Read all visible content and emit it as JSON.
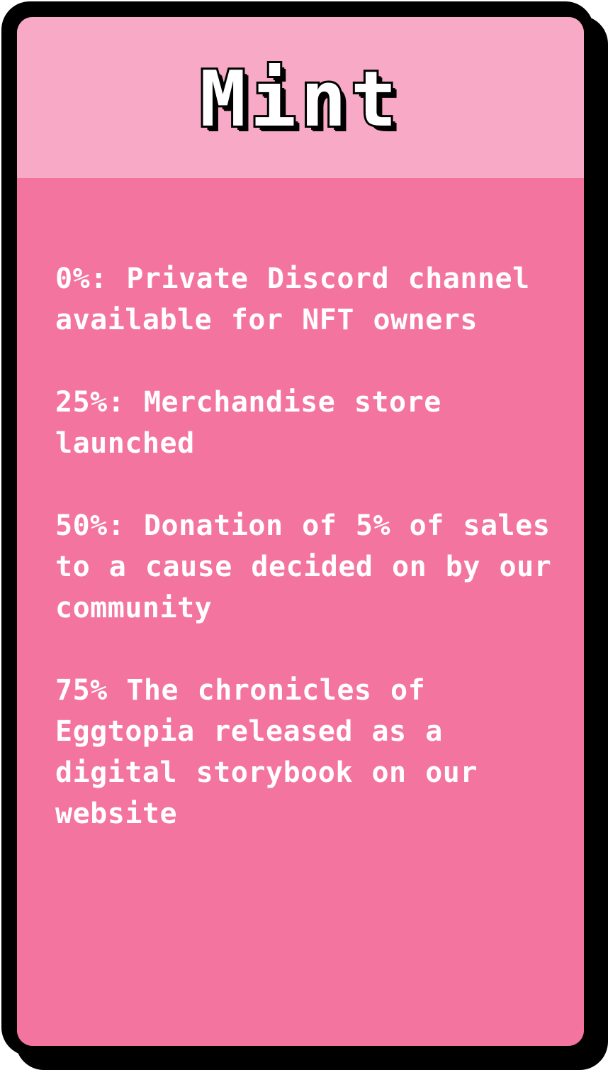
{
  "card": {
    "title": "Mint",
    "milestones": [
      {
        "text": "0%: Private Discord channel available for NFT owners"
      },
      {
        "text": "25%: Merchandise store launched"
      },
      {
        "text": "50%: Donation of 5% of sales to a cause decided on by our community"
      },
      {
        "text": "75% The chronicles of Eggtopia released as a digital storybook on our website"
      }
    ]
  },
  "colors": {
    "header_bg": "#f8a9c6",
    "body_bg": "#f474a0",
    "border": "#000000",
    "text": "#ffffff"
  }
}
